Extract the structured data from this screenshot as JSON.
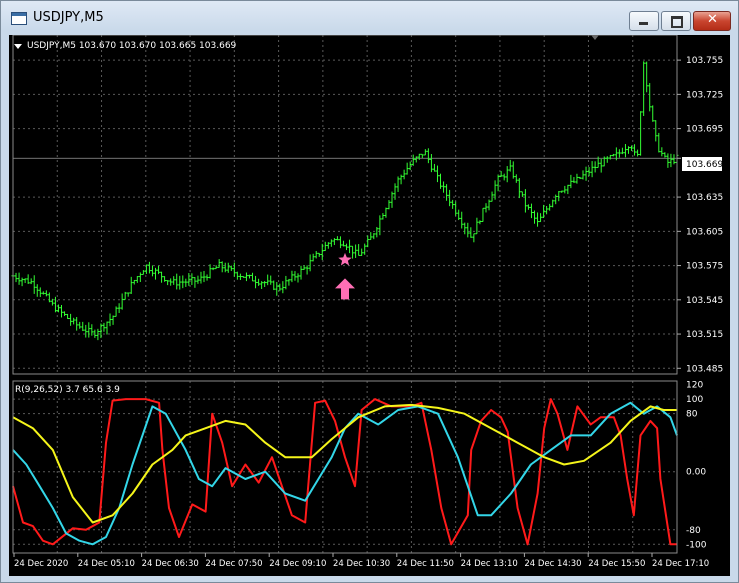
{
  "window": {
    "title": "USDJPY,M5",
    "buttons": {
      "minimize": "minimize-icon",
      "maximize": "maximize-icon",
      "close": "close-icon"
    }
  },
  "main_header": "USDJPY,M5  103.670 103.670 103.665 103.669",
  "current_price": "103.669",
  "indicator_header": "R(9,26,52) 3.7 65.6 3.9",
  "colors": {
    "background": "#000000",
    "bars": "#33ff33",
    "grid": "#5a5a5a",
    "line_red": "#ff1a1a",
    "line_cyan": "#33d6e8",
    "line_yellow": "#f5f51a",
    "markers": "#ff6fb5"
  },
  "chart_data": [
    {
      "type": "bar",
      "title": "USDJPY,M5",
      "ylim": [
        103.48,
        103.77
      ],
      "y_ticks": [
        "103.755",
        "103.725",
        "103.695",
        "103.669",
        "103.635",
        "103.605",
        "103.575",
        "103.545",
        "103.515",
        "103.485"
      ],
      "y_tick_values": [
        103.755,
        103.725,
        103.695,
        103.669,
        103.635,
        103.605,
        103.575,
        103.545,
        103.515,
        103.485
      ],
      "close_path": [
        [
          0,
          103.566
        ],
        [
          0.03,
          103.56
        ],
        [
          0.06,
          103.54
        ],
        [
          0.09,
          103.525
        ],
        [
          0.12,
          103.515
        ],
        [
          0.15,
          103.53
        ],
        [
          0.18,
          103.56
        ],
        [
          0.2,
          103.575
        ],
        [
          0.24,
          103.56
        ],
        [
          0.28,
          103.562
        ],
        [
          0.31,
          103.575
        ],
        [
          0.35,
          103.565
        ],
        [
          0.38,
          103.56
        ],
        [
          0.4,
          103.555
        ],
        [
          0.44,
          103.573
        ],
        [
          0.48,
          103.598
        ],
        [
          0.5,
          103.595
        ],
        [
          0.52,
          103.583
        ],
        [
          0.54,
          103.6
        ],
        [
          0.56,
          103.625
        ],
        [
          0.58,
          103.65
        ],
        [
          0.6,
          103.665
        ],
        [
          0.62,
          103.675
        ],
        [
          0.64,
          103.65
        ],
        [
          0.67,
          103.62
        ],
        [
          0.69,
          103.6
        ],
        [
          0.71,
          103.625
        ],
        [
          0.73,
          103.65
        ],
        [
          0.75,
          103.66
        ],
        [
          0.77,
          103.63
        ],
        [
          0.79,
          103.612
        ],
        [
          0.82,
          103.64
        ],
        [
          0.85,
          103.65
        ],
        [
          0.88,
          103.663
        ],
        [
          0.91,
          103.672
        ],
        [
          0.93,
          103.683
        ],
        [
          0.94,
          103.665
        ],
        [
          0.95,
          103.755
        ],
        [
          0.96,
          103.71
        ],
        [
          0.97,
          103.68
        ],
        [
          0.985,
          103.665
        ],
        [
          1.0,
          103.669
        ]
      ],
      "markers": [
        {
          "type": "star",
          "x": 0.5,
          "y": 103.58
        },
        {
          "type": "up-arrow",
          "x": 0.5,
          "y": 103.555
        }
      ]
    },
    {
      "type": "line",
      "title": "R(9,26,52)",
      "ylim": [
        -112,
        125
      ],
      "y_ticks": [
        "120",
        "100",
        "80",
        "0.00",
        "-80",
        "-100"
      ],
      "y_tick_values": [
        120,
        100,
        80,
        0,
        -80,
        -100
      ],
      "x_labels": [
        "24 Dec 2020",
        "24 Dec 05:10",
        "24 Dec 06:30",
        "24 Dec 07:50",
        "24 Dec 09:10",
        "24 Dec 10:30",
        "24 Dec 11:50",
        "24 Dec 13:10",
        "24 Dec 14:30",
        "24 Dec 15:50",
        "24 Dec 17:10"
      ],
      "series": [
        {
          "color": "#ff1a1a",
          "values": [
            [
              0,
              -20
            ],
            [
              0.015,
              -70
            ],
            [
              0.03,
              -75
            ],
            [
              0.045,
              -95
            ],
            [
              0.06,
              -100
            ],
            [
              0.09,
              -78
            ],
            [
              0.11,
              -80
            ],
            [
              0.13,
              -70
            ],
            [
              0.14,
              40
            ],
            [
              0.15,
              98
            ],
            [
              0.17,
              100
            ],
            [
              0.2,
              100
            ],
            [
              0.22,
              95
            ],
            [
              0.225,
              30
            ],
            [
              0.235,
              -50
            ],
            [
              0.25,
              -90
            ],
            [
              0.27,
              -45
            ],
            [
              0.29,
              -55
            ],
            [
              0.3,
              80
            ],
            [
              0.315,
              40
            ],
            [
              0.33,
              -20
            ],
            [
              0.35,
              10
            ],
            [
              0.37,
              -15
            ],
            [
              0.39,
              20
            ],
            [
              0.42,
              -60
            ],
            [
              0.44,
              -70
            ],
            [
              0.455,
              95
            ],
            [
              0.47,
              98
            ],
            [
              0.485,
              70
            ],
            [
              0.5,
              20
            ],
            [
              0.515,
              -20
            ],
            [
              0.525,
              85
            ],
            [
              0.545,
              100
            ],
            [
              0.57,
              90
            ],
            [
              0.6,
              90
            ],
            [
              0.615,
              95
            ],
            [
              0.63,
              30
            ],
            [
              0.645,
              -50
            ],
            [
              0.66,
              -100
            ],
            [
              0.685,
              -60
            ],
            [
              0.69,
              30
            ],
            [
              0.705,
              70
            ],
            [
              0.72,
              85
            ],
            [
              0.735,
              75
            ],
            [
              0.745,
              55
            ],
            [
              0.76,
              -50
            ],
            [
              0.775,
              -100
            ],
            [
              0.79,
              -30
            ],
            [
              0.8,
              60
            ],
            [
              0.81,
              100
            ],
            [
              0.82,
              80
            ],
            [
              0.835,
              30
            ],
            [
              0.85,
              90
            ],
            [
              0.87,
              65
            ],
            [
              0.885,
              75
            ],
            [
              0.905,
              75
            ],
            [
              0.915,
              50
            ],
            [
              0.925,
              -10
            ],
            [
              0.935,
              -60
            ],
            [
              0.945,
              50
            ],
            [
              0.96,
              70
            ],
            [
              0.97,
              60
            ],
            [
              0.975,
              -10
            ],
            [
              0.99,
              -100
            ],
            [
              1.0,
              -100
            ]
          ]
        },
        {
          "color": "#33d6e8",
          "values": [
            [
              0,
              30
            ],
            [
              0.02,
              10
            ],
            [
              0.04,
              -20
            ],
            [
              0.06,
              -50
            ],
            [
              0.08,
              -85
            ],
            [
              0.1,
              -95
            ],
            [
              0.12,
              -100
            ],
            [
              0.14,
              -90
            ],
            [
              0.16,
              -50
            ],
            [
              0.18,
              10
            ],
            [
              0.21,
              90
            ],
            [
              0.23,
              80
            ],
            [
              0.26,
              30
            ],
            [
              0.28,
              -10
            ],
            [
              0.3,
              -20
            ],
            [
              0.32,
              5
            ],
            [
              0.35,
              -10
            ],
            [
              0.38,
              0
            ],
            [
              0.41,
              -30
            ],
            [
              0.44,
              -40
            ],
            [
              0.46,
              -10
            ],
            [
              0.48,
              20
            ],
            [
              0.5,
              60
            ],
            [
              0.52,
              80
            ],
            [
              0.55,
              65
            ],
            [
              0.58,
              85
            ],
            [
              0.61,
              90
            ],
            [
              0.64,
              80
            ],
            [
              0.67,
              20
            ],
            [
              0.7,
              -60
            ],
            [
              0.72,
              -60
            ],
            [
              0.75,
              -30
            ],
            [
              0.78,
              10
            ],
            [
              0.81,
              30
            ],
            [
              0.84,
              50
            ],
            [
              0.87,
              50
            ],
            [
              0.9,
              80
            ],
            [
              0.93,
              95
            ],
            [
              0.95,
              80
            ],
            [
              0.97,
              90
            ],
            [
              0.99,
              75
            ],
            [
              1.0,
              50
            ]
          ]
        },
        {
          "color": "#f5f51a",
          "values": [
            [
              0,
              75
            ],
            [
              0.03,
              60
            ],
            [
              0.06,
              30
            ],
            [
              0.09,
              -35
            ],
            [
              0.12,
              -70
            ],
            [
              0.15,
              -60
            ],
            [
              0.18,
              -30
            ],
            [
              0.21,
              10
            ],
            [
              0.24,
              30
            ],
            [
              0.26,
              50
            ],
            [
              0.29,
              60
            ],
            [
              0.32,
              70
            ],
            [
              0.35,
              65
            ],
            [
              0.38,
              40
            ],
            [
              0.41,
              20
            ],
            [
              0.45,
              20
            ],
            [
              0.48,
              45
            ],
            [
              0.52,
              75
            ],
            [
              0.56,
              90
            ],
            [
              0.6,
              92
            ],
            [
              0.64,
              88
            ],
            [
              0.68,
              80
            ],
            [
              0.72,
              60
            ],
            [
              0.76,
              40
            ],
            [
              0.8,
              20
            ],
            [
              0.83,
              10
            ],
            [
              0.86,
              15
            ],
            [
              0.9,
              40
            ],
            [
              0.93,
              70
            ],
            [
              0.96,
              90
            ],
            [
              0.98,
              85
            ],
            [
              1.0,
              85
            ]
          ]
        }
      ]
    }
  ]
}
